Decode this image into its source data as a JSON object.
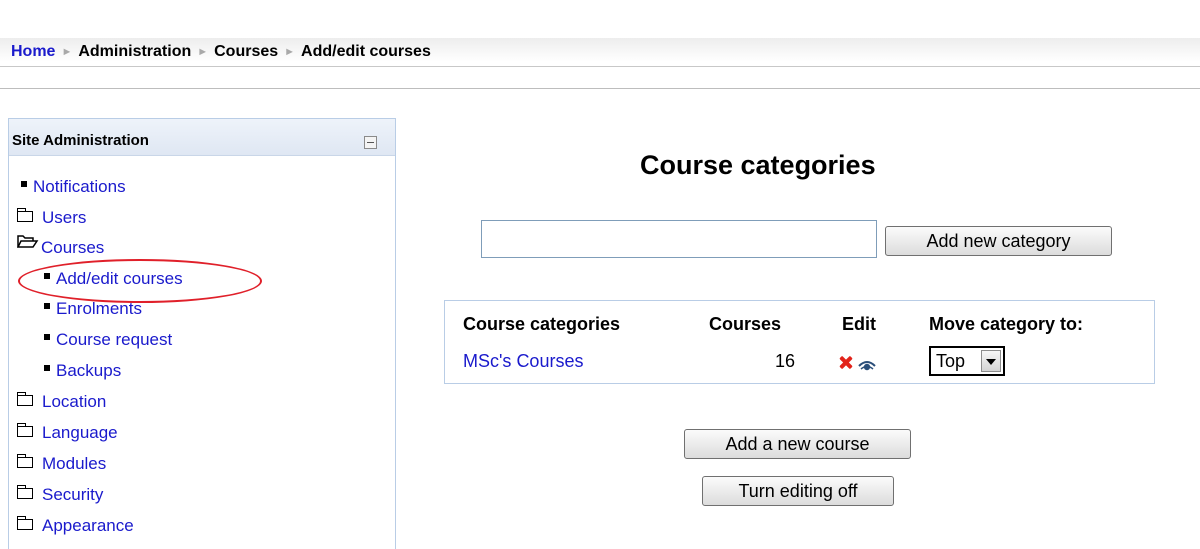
{
  "breadcrumb": {
    "items": [
      "Home",
      "Administration",
      "Courses",
      "Add/edit courses"
    ],
    "separator": "►"
  },
  "sidebar": {
    "title": "Site Administration",
    "items": [
      {
        "label": "Notifications",
        "icon": "bullet-icon"
      },
      {
        "label": "Users",
        "icon": "folder-icon"
      },
      {
        "label": "Courses",
        "icon": "folder-open-icon"
      },
      {
        "label": "Add/edit courses",
        "icon": "bullet-icon"
      },
      {
        "label": "Enrolments",
        "icon": "bullet-icon"
      },
      {
        "label": "Course request",
        "icon": "bullet-icon"
      },
      {
        "label": "Backups",
        "icon": "bullet-icon"
      },
      {
        "label": "Location",
        "icon": "folder-icon"
      },
      {
        "label": "Language",
        "icon": "folder-icon"
      },
      {
        "label": "Modules",
        "icon": "folder-icon"
      },
      {
        "label": "Security",
        "icon": "folder-icon"
      },
      {
        "label": "Appearance",
        "icon": "folder-icon"
      }
    ]
  },
  "main": {
    "title": "Course categories",
    "new_category_value": "",
    "add_category_label": "Add new category",
    "table": {
      "headers": [
        "Course categories",
        "Courses",
        "Edit",
        "Move category to:"
      ],
      "rows": [
        {
          "name": "MSc's Courses",
          "courses": "16",
          "move_to": "Top"
        }
      ]
    },
    "add_course_label": "Add a new course",
    "turn_editing_off_label": "Turn editing off"
  },
  "colors": {
    "link": "#1a1acc",
    "highlight_circle": "#e0202a",
    "delete_icon": "#e2231a",
    "block_border": "#b9cde6"
  }
}
